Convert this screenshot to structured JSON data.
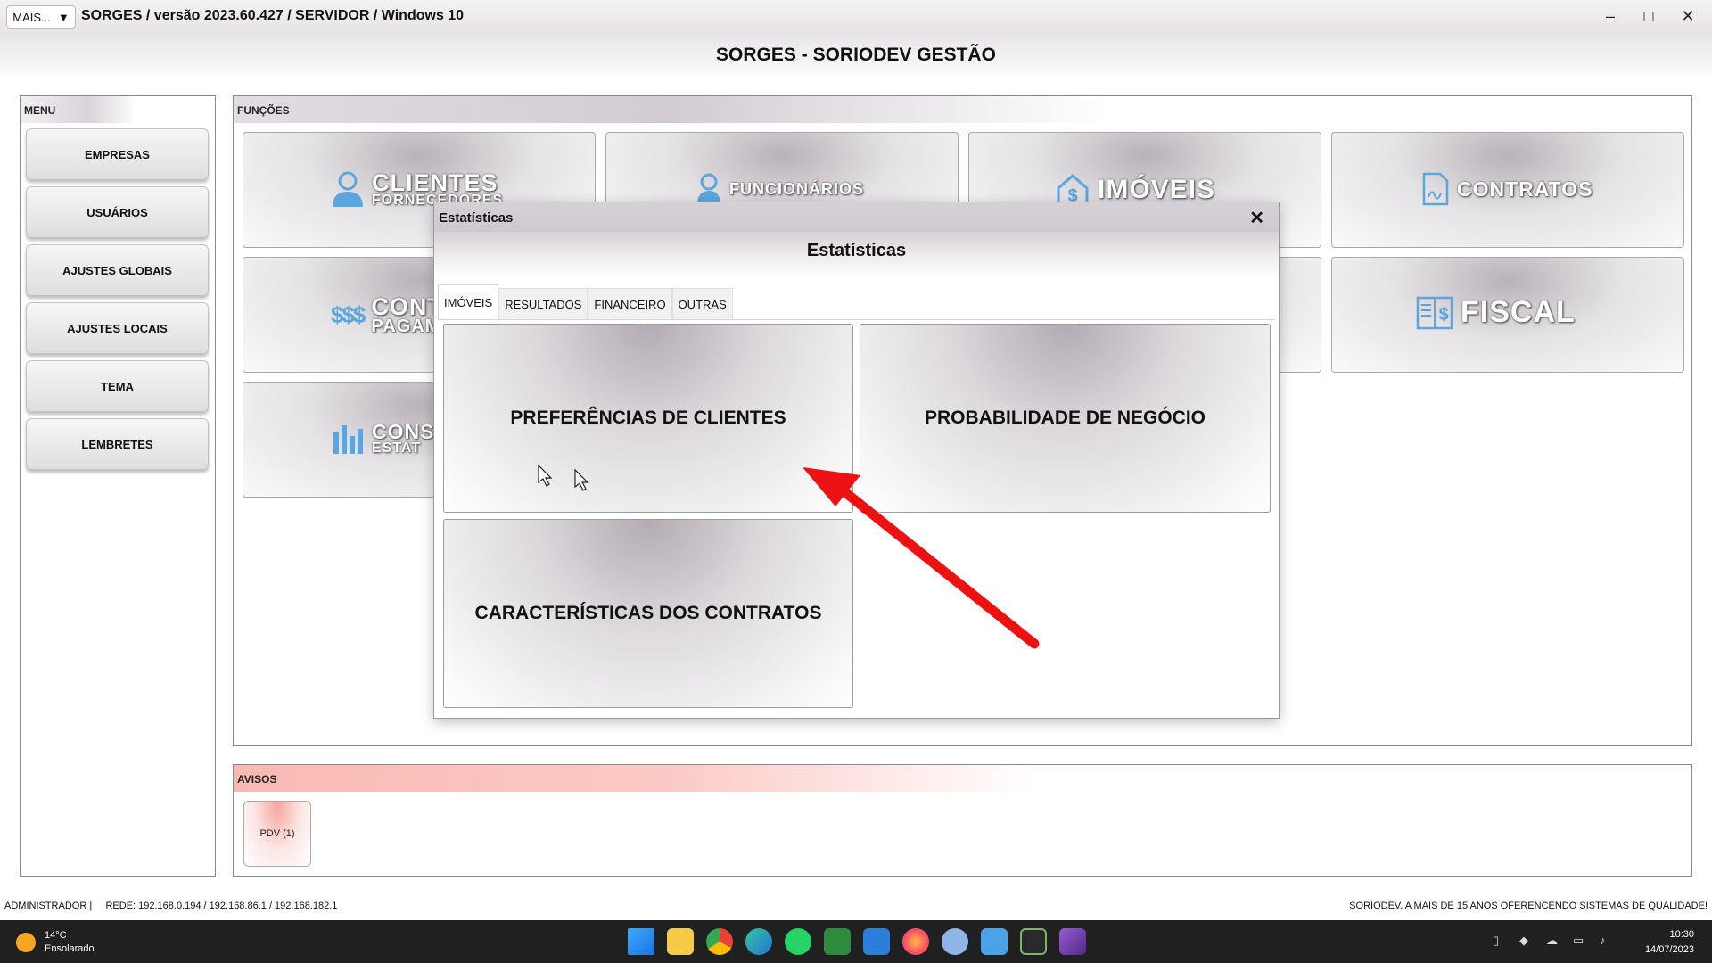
{
  "window": {
    "mais_label": "MAIS...",
    "title": "SORGES / versão 2023.60.427 / SERVIDOR / Windows 10",
    "minimize": "–",
    "maximize": "☐",
    "close": "✕"
  },
  "app": {
    "heading": "SORGES - SORIODEV GESTÃO"
  },
  "menu": {
    "header": "MENU",
    "items": [
      {
        "label": "EMPRESAS"
      },
      {
        "label": "USUÁRIOS"
      },
      {
        "label": "AJUSTES GLOBAIS"
      },
      {
        "label": "AJUSTES LOCAIS"
      },
      {
        "label": "TEMA"
      },
      {
        "label": "LEMBRETES"
      }
    ]
  },
  "functions": {
    "header": "FUNÇÕES",
    "tiles": [
      {
        "label": "CLIENTES",
        "sub": "FORNECEDORES",
        "icon": "person-icon"
      },
      {
        "label": "FUNCIONÁRIOS",
        "icon": "employee-icon"
      },
      {
        "label": "IMÓVEIS",
        "icon": "house-dollar-icon"
      },
      {
        "label": "CONTRATOS",
        "icon": "contract-icon"
      },
      {
        "label": "CONT",
        "sub": "PAGAM",
        "icon": "money-icon",
        "icon_text": "$$$"
      },
      {
        "label": "FISCAL",
        "icon": "fiscal-book-icon"
      },
      {
        "label": "CONS",
        "sub": "ESTAT",
        "icon": "bar-chart-icon"
      }
    ]
  },
  "avisos": {
    "header": "AVISOS",
    "pdv_label": "PDV (1)"
  },
  "status": {
    "left": "ADMINISTRADOR |     REDE: 192.168.0.194 / 192.168.86.1 / 192.168.182.1",
    "right": "SORIODEV, A MAIS DE 15 ANOS OFERENCENDO SISTEMAS DE QUALIDADE!"
  },
  "dialog": {
    "title": "Estatísticas",
    "heading": "Estatísticas",
    "close": "✕",
    "tabs": [
      {
        "label": "IMÓVEIS",
        "active": true
      },
      {
        "label": "RESULTADOS"
      },
      {
        "label": "FINANCEIRO"
      },
      {
        "label": "OUTRAS"
      }
    ],
    "buttons": {
      "preferencias": "PREFERÊNCIAS DE CLIENTES",
      "probabilidade": "PROBABILIDADE DE NEGÓCIO",
      "caracteristicas": "CARACTERÍSTICAS DOS CONTRATOS"
    }
  },
  "taskbar": {
    "weather_temp": "14°C",
    "weather_desc": "Ensolarado",
    "time": "10:30",
    "date": "14/07/2023",
    "apps": [
      "windows-start-icon",
      "file-explorer-icon",
      "chrome-icon",
      "edge-icon",
      "whatsapp-icon",
      "spreadsheet-icon",
      "mail-icon",
      "firefox-icon",
      "settings-icon",
      "notepad-icon",
      "sorges-icon",
      "video-editor-icon"
    ]
  },
  "colors": {
    "arrow": "#ee1111",
    "aviso_header": "#f9b9b3",
    "icon_blue": "#5aa7e0"
  }
}
